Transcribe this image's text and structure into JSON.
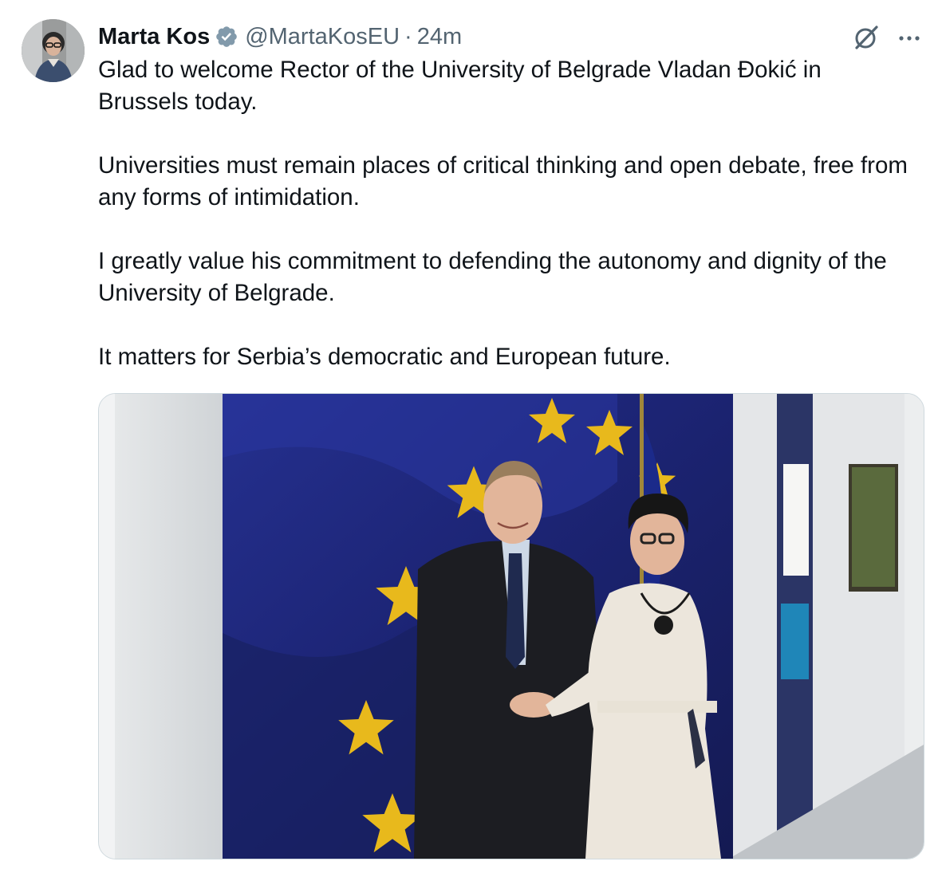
{
  "author": {
    "display_name": "Marta Kos",
    "handle": "@MartaKosEU",
    "separator": "·",
    "timestamp": "24m",
    "verified": true
  },
  "icons": {
    "verified": "verified-badge-icon",
    "grok": "grok-icon",
    "more": "more-options-icon"
  },
  "tweet": {
    "paragraphs": [
      "Glad to welcome Rector of the University of Belgrade Vladan Đokić in Brussels today.",
      "Universities must remain places of critical thinking and open debate, free from any forms of intimidation.",
      "I greatly value his commitment to defending the autonomy and dignity of the University of Belgrade.",
      "It matters for Serbia’s democratic and European future."
    ]
  },
  "colors": {
    "text": "#0f1419",
    "secondary": "#536471",
    "verified_badge": "#829aab",
    "eu_blue": "#1f2a8c",
    "eu_star": "#e8b91c"
  }
}
